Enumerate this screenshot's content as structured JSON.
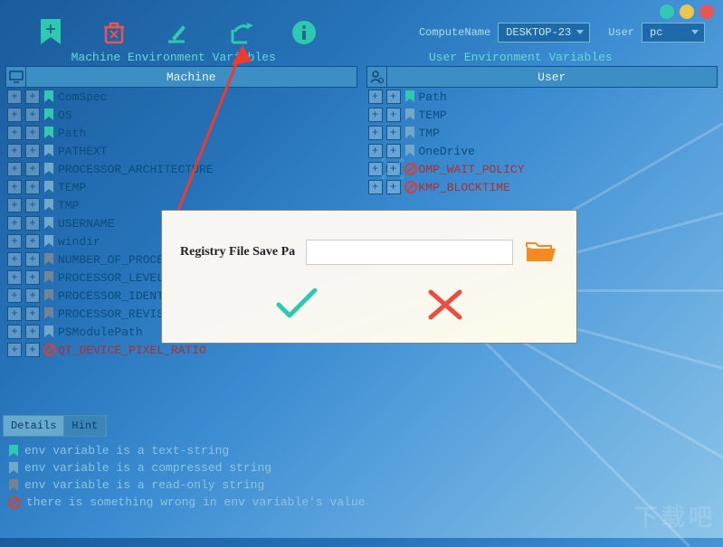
{
  "window": {
    "dots": [
      "#33c8b6",
      "#eac64d",
      "#e95552"
    ]
  },
  "toolbar": {
    "computename_label": "ComputeName",
    "computename_value": "DESKTOP-23",
    "user_label": "User",
    "user_value": "pc"
  },
  "sections": {
    "machine_title": "Machine Environment Variables",
    "user_title": "User Environment Variables",
    "machine_header": "Machine",
    "user_header": "User"
  },
  "machine_vars": [
    {
      "name": "ComSpec",
      "color": "#2fc8b0"
    },
    {
      "name": "OS",
      "color": "#2fc8b0"
    },
    {
      "name": "Path",
      "color": "#2fc8b0"
    },
    {
      "name": "PATHEXT",
      "color": "#6fa8c8"
    },
    {
      "name": "PROCESSOR_ARCHITECTURE",
      "color": "#6fa8c8"
    },
    {
      "name": "TEMP",
      "color": "#6fa8c8"
    },
    {
      "name": "TMP",
      "color": "#6fa8c8"
    },
    {
      "name": "USERNAME",
      "color": "#6fa8c8"
    },
    {
      "name": "windir",
      "color": "#6fa8c8"
    },
    {
      "name": "NUMBER_OF_PROCESSORS",
      "color": "#708696"
    },
    {
      "name": "PROCESSOR_LEVEL",
      "color": "#708696"
    },
    {
      "name": "PROCESSOR_IDENTIFIER",
      "color": "#708696"
    },
    {
      "name": "PROCESSOR_REVISION",
      "color": "#708696"
    },
    {
      "name": "PSModulePath",
      "color": "#6fa8c8"
    },
    {
      "name": "QT_DEVICE_PIXEL_RATIO",
      "color": "#b32d2d",
      "red": true
    }
  ],
  "user_vars": [
    {
      "name": "Path",
      "color": "#2fc8b0"
    },
    {
      "name": "TEMP",
      "color": "#6fa8c8"
    },
    {
      "name": "TMP",
      "color": "#6fa8c8"
    },
    {
      "name": "OneDrive",
      "color": "#6fa8c8"
    },
    {
      "name": "OMP_WAIT_POLICY",
      "color": "#b32d2d",
      "red": true
    },
    {
      "name": "KMP_BLOCKTIME",
      "color": "#b32d2d",
      "red": true
    }
  ],
  "dialog": {
    "label": "Registry File Save Pa",
    "input_value": ""
  },
  "footer": {
    "tab_details": "Details",
    "tab_hint": "Hint"
  },
  "legend": {
    "l1": "env variable is a text-string",
    "l2": "env variable is a compressed string",
    "l3": "env variable is a read-only string",
    "l4": "there is something wrong in env variable's value"
  },
  "watermark": "下载吧"
}
